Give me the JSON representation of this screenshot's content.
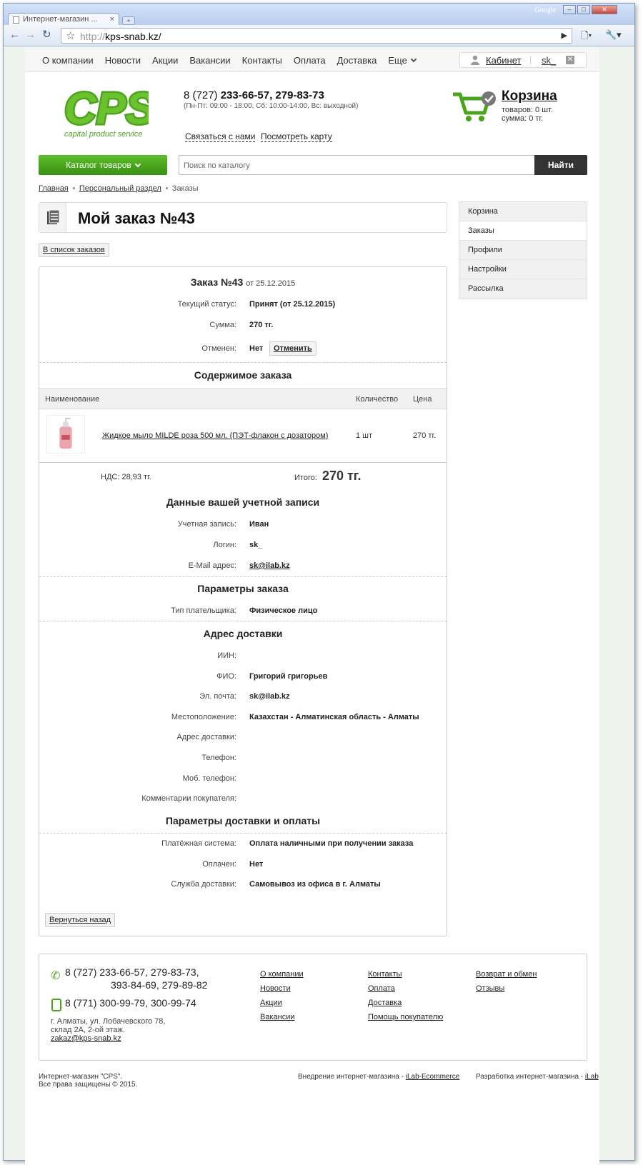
{
  "browser": {
    "tab_title": "Интернет-магазин ...",
    "tab_close": "×",
    "new_tab": "+",
    "brand": "Google",
    "url_proto": "http://",
    "url_host": "kps-snab.kz/"
  },
  "topnav": {
    "items": [
      "О компании",
      "Новости",
      "Акции",
      "Вакансии",
      "Контакты",
      "Оплата",
      "Доставка",
      "Еще"
    ],
    "cabinet": "Кабинет",
    "username": "sk_",
    "logout": "✕"
  },
  "header": {
    "logo_text": "CPS",
    "logo_tagline": "capital product service",
    "phone_prefix": "8 (727) ",
    "phone_numbers": "233-66-57, 279-83-73",
    "hours": "(Пн-Пт: 09:00 - 18:00,  Сб: 10:00-14:00, Вс: выходной)",
    "contact_link": "Связаться с нами",
    "map_link": "Посмотреть карту",
    "cart_title": "Корзина",
    "cart_items": "товаров: 0 шт.",
    "cart_sum": "сумма: 0 тг."
  },
  "catalog_button": "Каталог товаров",
  "search": {
    "placeholder": "Поиск по каталогу",
    "button": "Найти"
  },
  "breadcrumbs": [
    "Главная",
    "Персональный раздел",
    "Заказы"
  ],
  "page_title": "Мой заказ №43",
  "back_to_list": "В список заказов",
  "sidebar": [
    "Корзина",
    "Заказы",
    "Профили",
    "Настройки",
    "Рассылка"
  ],
  "order": {
    "title": "Заказ №43",
    "date": "от 25.12.2015",
    "status_label": "Текущий статус:",
    "status_value": "Принят (от 25.12.2015)",
    "sum_label": "Сумма:",
    "sum_value": "270 тг.",
    "canceled_label": "Отменен:",
    "canceled_value": "Нет",
    "cancel_button": "Отменить",
    "contents_title": "Содержимое заказа",
    "col_name": "Наименование",
    "col_qty": "Количество",
    "col_price": "Цена",
    "item_name": "Жидкое мыло MILDE роза 500 мл. (ПЭТ-флакон с дозатором)",
    "item_qty": "1 шт",
    "item_price": "270 тг.",
    "vat": "НДС: 28,93 тг.",
    "total_label": "Итого:",
    "total_value": "270 тг.",
    "account_title": "Данные вашей учетной записи",
    "account_label": "Учетная запись:",
    "account_value": "Иван",
    "login_label": "Логин:",
    "login_value": "sk_",
    "email_label": "E-Mail адрес:",
    "email_value": "sk@ilab.kz",
    "params_title": "Параметры заказа",
    "payer_label": "Тип плательщика:",
    "payer_value": "Физическое лицо",
    "address_title": "Адрес доставки",
    "iin_label": "ИИН:",
    "fio_label": "ФИО:",
    "fio_value": "Григорий григорьев",
    "mail_label": "Эл. почта:",
    "mail_value": "sk@ilab.kz",
    "location_label": "Местоположение:",
    "location_value": "Казахстан - Алматинская область - Алматы",
    "deliv_addr_label": "Адрес доставки:",
    "phone_label": "Телефон:",
    "mobile_label": "Моб. телефон:",
    "comment_label": "Комментарии покупателя:",
    "delivery_title": "Параметры доставки и оплаты",
    "paysys_label": "Платёжная система:",
    "paysys_value": "Оплата наличными при получении заказа",
    "paid_label": "Оплачен:",
    "paid_value": "Нет",
    "service_label": "Служба доставки:",
    "service_value": "Самовывоз из офиса в г. Алматы",
    "back_button": "Вернуться назад"
  },
  "footer": {
    "phone1_line1": "8 (727) 233-66-57, 279-83-73,",
    "phone1_line2": "393-84-69, 279-89-82",
    "phone2": "8 (771) 300-99-79, 300-99-74",
    "addr1": "г. Алматы, ул. Лобачевского 78,",
    "addr2": "склад  2А, 2-ой этаж.",
    "email": "zakaz@kps-snab.kz",
    "col1": [
      "О компании",
      "Новости",
      "Акции",
      "Вакансии"
    ],
    "col2": [
      "Контакты",
      "Оплата",
      "Доставка",
      "Помощь покупателю"
    ],
    "col3": [
      "Возврат и обмен",
      "Отзывы"
    ],
    "copy1": "Интернет-магазин \"CPS\".",
    "copy2": "Все права защищены © 2015.",
    "impl_text": "Внедрение интернет-магазина - ",
    "impl_link": "iLab-Ecommerce",
    "dev_text": "Разработка интернет-магазина - ",
    "dev_link": "iLab"
  },
  "colors": {
    "brand_green": "#4aa51c",
    "dark_button": "#333333"
  }
}
